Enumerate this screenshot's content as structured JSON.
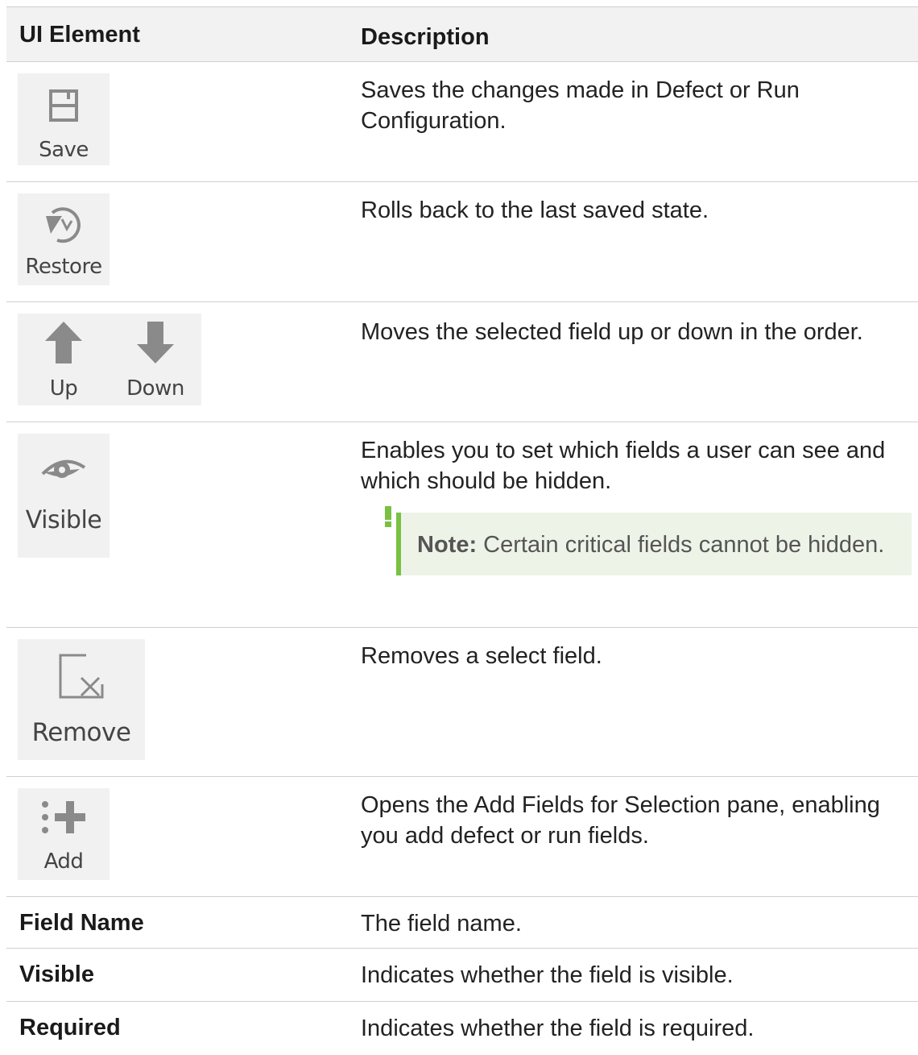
{
  "header": {
    "col1": "UI Element",
    "col2": "Description"
  },
  "rows": [
    {
      "buttons": [
        {
          "label": "Save",
          "icon": "save-icon"
        }
      ],
      "description": "Saves the changes made in Defect or Run Configuration."
    },
    {
      "buttons": [
        {
          "label": "Restore",
          "icon": "restore-icon"
        }
      ],
      "description": "Rolls back to the last saved state."
    },
    {
      "buttons": [
        {
          "label": "Up",
          "icon": "arrow-up-icon"
        },
        {
          "label": "Down",
          "icon": "arrow-down-icon"
        }
      ],
      "description": "Moves the selected field up or down in the order."
    },
    {
      "buttons": [
        {
          "label": "Visible",
          "icon": "eye-icon"
        }
      ],
      "description": "Enables you to set which fields a user can see and which should be hidden.",
      "note": {
        "prefix": "Note:",
        "text": "Certain critical fields cannot be hidden."
      }
    },
    {
      "buttons": [
        {
          "label": "Remove",
          "icon": "remove-icon"
        }
      ],
      "description": "Removes a select field."
    },
    {
      "buttons": [
        {
          "label": "Add",
          "icon": "add-icon"
        }
      ],
      "description": "Opens the Add Fields for Selection pane, enabling you add defect or run fields."
    }
  ],
  "text_rows": [
    {
      "label": "Field Name",
      "description": "The field name."
    },
    {
      "label": "Visible",
      "description": "Indicates whether the field is visible."
    },
    {
      "label": "Required",
      "description": "Indicates whether the field is required."
    }
  ],
  "colors": {
    "note_accent": "#7ac143",
    "note_bg": "#eef3e8",
    "header_bg": "#f2f2f2",
    "icon_gray": "#8a8a8a"
  }
}
